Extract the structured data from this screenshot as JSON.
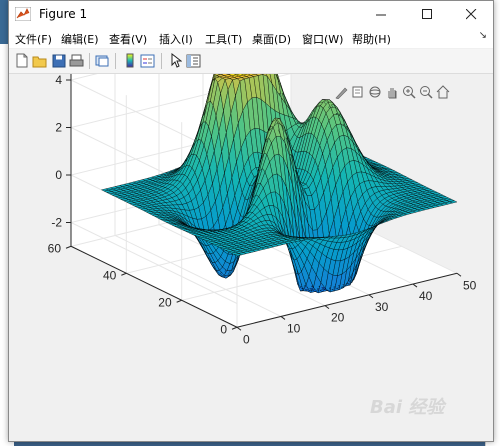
{
  "window": {
    "title": "Figure 1"
  },
  "menu": [
    "文件(F)",
    "编辑(E)",
    "查看(V)",
    "插入(I)",
    "工具(T)",
    "桌面(D)",
    "窗口(W)",
    "帮助(H)"
  ],
  "toolbar": [
    "new-figure-icon",
    "open-icon",
    "save-icon",
    "print-icon",
    "link-plot-icon",
    "insert-colorbar-icon",
    "insert-legend-icon",
    "edit-plot-icon",
    "property-inspector-icon"
  ],
  "axes_toolbar": [
    "brush-icon",
    "datatip-icon",
    "rotate-3d-icon",
    "pan-icon",
    "zoom-in-icon",
    "zoom-out-icon",
    "home-icon"
  ],
  "chart_data": {
    "type": "surface",
    "function": "peaks",
    "colormap": "parula",
    "x": {
      "ticks": [
        0,
        10,
        20,
        30,
        40,
        50
      ],
      "lim": [
        0,
        50
      ]
    },
    "y": {
      "ticks": [
        0,
        20,
        40,
        60
      ],
      "lim": [
        0,
        60
      ]
    },
    "z": {
      "ticks": [
        -2,
        0,
        2,
        4
      ],
      "lim": [
        -3,
        4.5
      ]
    },
    "grid": true,
    "mesh": [
      49,
      49
    ]
  },
  "watermark": "Bai 经验"
}
